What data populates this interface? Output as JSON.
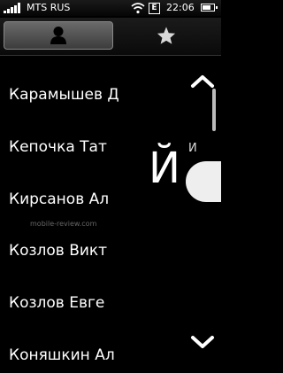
{
  "status_bar": {
    "carrier": "MTS RUS",
    "network_badge": "E",
    "time": "22:06",
    "battery_level": 0.75,
    "icons": [
      "signal-icon",
      "wifi-icon",
      "battery-icon"
    ]
  },
  "tabs": [
    {
      "name": "contacts",
      "icon": "person-icon",
      "selected": true
    },
    {
      "name": "favorites",
      "icon": "star-icon",
      "selected": false
    }
  ],
  "contacts": [
    "Карамышев Д",
    "Кепочка Тат",
    "Кирсанов Ал",
    "Козлов Викт",
    "Козлов Евге",
    "Коняшкин Ал"
  ],
  "index": {
    "small_letter": "И",
    "current_letter": "Й"
  },
  "watermark": "mobile-review.com",
  "colors": {
    "background": "#000000",
    "tab_selected": "#555555",
    "text": "#ffffff"
  }
}
